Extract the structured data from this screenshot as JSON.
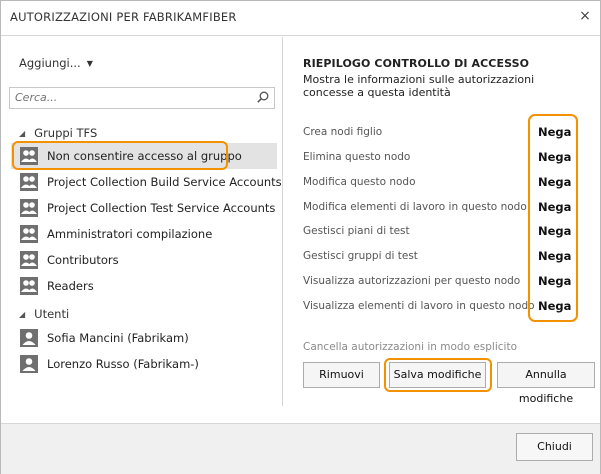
{
  "dialog": {
    "title": "AUTORIZZAZIONI PER FABRIKAMFIBER",
    "close_glyph": "×"
  },
  "left": {
    "add_label": "Aggiungi...",
    "search_placeholder": "Cerca...",
    "groups": [
      {
        "label": "Gruppi TFS",
        "items": [
          {
            "label": "Non consentire accesso al gruppo",
            "selected": true
          },
          {
            "label": "Project Collection Build Service Accounts"
          },
          {
            "label": "Project Collection Test Service Accounts"
          },
          {
            "label": "Amministratori compilazione"
          },
          {
            "label": "Contributors"
          },
          {
            "label": "Readers"
          }
        ]
      },
      {
        "label": "Utenti",
        "items": [
          {
            "label": "Sofia Mancini (Fabrikam)"
          },
          {
            "label": "Lorenzo Russo (Fabrikam-)"
          }
        ]
      }
    ]
  },
  "right": {
    "title": "RIEPILOGO CONTROLLO DI ACCESSO",
    "description": "Mostra le informazioni sulle autorizzazioni concesse a questa identità",
    "permissions": [
      {
        "name": "Crea nodi figlio",
        "value": "Nega"
      },
      {
        "name": "Elimina questo nodo",
        "value": "Nega"
      },
      {
        "name": "Modifica questo nodo",
        "value": "Nega"
      },
      {
        "name": "Modifica elementi di lavoro in questo nodo",
        "value": "Nega"
      },
      {
        "name": "Gestisci piani di test",
        "value": "Nega"
      },
      {
        "name": "Gestisci gruppi di test",
        "value": "Nega"
      },
      {
        "name": "Visualizza autorizzazioni per questo nodo",
        "value": "Nega"
      },
      {
        "name": "Visualizza elementi di lavoro in questo nodo",
        "value": "Nega"
      }
    ],
    "clear_label": "Cancella autorizzazioni in modo esplicito",
    "remove_label": "Rimuovi",
    "save_label": "Salva modifiche",
    "undo_label": "Annulla modifiche"
  },
  "footer": {
    "close_label": "Chiudi"
  },
  "colors": {
    "highlight": "#f39200",
    "selected_row": "#e3e3e3"
  }
}
